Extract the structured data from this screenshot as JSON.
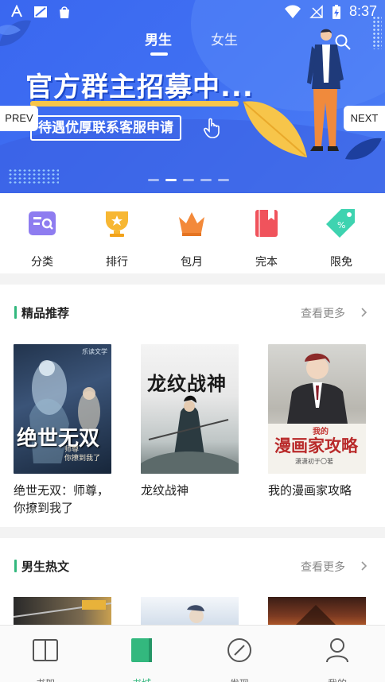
{
  "status_bar": {
    "time": "8:37"
  },
  "header": {
    "tabs": [
      {
        "label": "男生",
        "active": true
      },
      {
        "label": "女生",
        "active": false
      }
    ]
  },
  "banner": {
    "title": "官方群主招募中...",
    "subtitle": "待遇优厚联系客服申请",
    "prev_label": "PREV",
    "next_label": "NEXT",
    "slide_count": 5,
    "active_slide": 2
  },
  "categories": [
    {
      "label": "分类",
      "icon": "category-icon"
    },
    {
      "label": "排行",
      "icon": "ranking-icon"
    },
    {
      "label": "包月",
      "icon": "crown-icon"
    },
    {
      "label": "完本",
      "icon": "book-icon"
    },
    {
      "label": "限免",
      "icon": "tag-icon"
    }
  ],
  "sections": [
    {
      "title": "精品推荐",
      "more_label": "查看更多",
      "books": [
        {
          "title": "绝世无双：师尊，你撩到我了",
          "cover_text": "绝世无双",
          "cover_subtext": "师尊\n你撩到我了",
          "cover_publisher": "乐读文学"
        },
        {
          "title": "龙纹战神",
          "cover_text": "龙纹战神"
        },
        {
          "title": "我的漫画家攻略",
          "cover_text": "漫画家攻略",
          "cover_prefix": "我的",
          "cover_author": "潇潇初于〇著"
        }
      ]
    },
    {
      "title": "男生热文",
      "more_label": "查看更多"
    }
  ],
  "bottom_nav": [
    {
      "label": "书架",
      "icon": "bookshelf-icon",
      "active": false
    },
    {
      "label": "书城",
      "icon": "bookstore-icon",
      "active": true
    },
    {
      "label": "发现",
      "icon": "discover-icon",
      "active": false
    },
    {
      "label": "我的",
      "icon": "profile-icon",
      "active": false
    }
  ],
  "colors": {
    "accent": "#33b87e",
    "banner_blue": "#3f6ff2",
    "highlight_yellow": "#f7c54a"
  }
}
